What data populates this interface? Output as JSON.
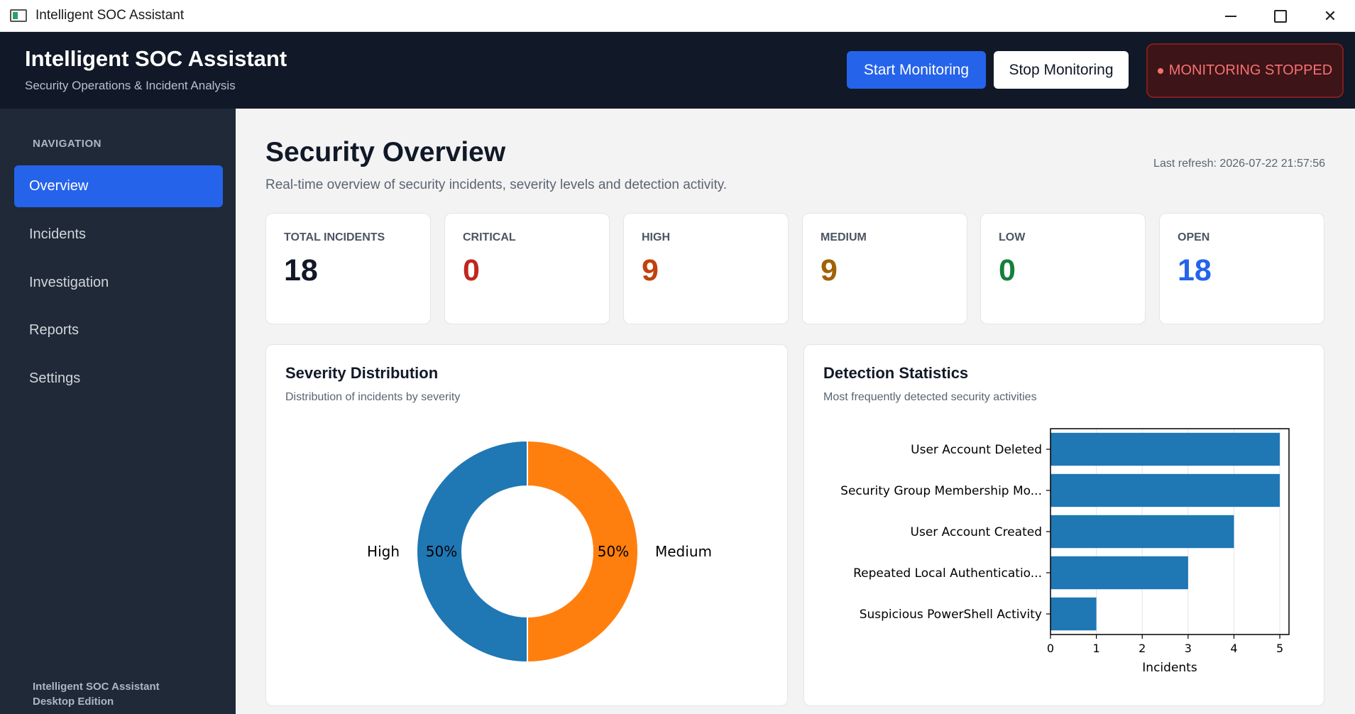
{
  "window": {
    "title": "Intelligent SOC Assistant"
  },
  "header": {
    "title": "Intelligent SOC Assistant",
    "subtitle": "Security Operations & Incident Analysis",
    "start_label": "Start Monitoring",
    "stop_label": "Stop Monitoring",
    "status_label": "MONITORING STOPPED"
  },
  "sidebar": {
    "heading": "NAVIGATION",
    "items": [
      {
        "label": "Overview",
        "active": true
      },
      {
        "label": "Incidents",
        "active": false
      },
      {
        "label": "Investigation",
        "active": false
      },
      {
        "label": "Reports",
        "active": false
      },
      {
        "label": "Settings",
        "active": false
      }
    ],
    "footer_line1": "Intelligent SOC Assistant",
    "footer_line2": "Desktop Edition"
  },
  "main": {
    "title": "Security Overview",
    "subtitle": "Real-time overview of security incidents, severity levels and detection activity.",
    "last_refresh": "Last refresh: 2026-07-22 21:57:56",
    "stats": [
      {
        "label": "TOTAL INCIDENTS",
        "value": "18",
        "color": "#111827"
      },
      {
        "label": "CRITICAL",
        "value": "0",
        "color": "#c0271f"
      },
      {
        "label": "HIGH",
        "value": "9",
        "color": "#c2410c"
      },
      {
        "label": "MEDIUM",
        "value": "9",
        "color": "#a16207"
      },
      {
        "label": "LOW",
        "value": "0",
        "color": "#15803d"
      },
      {
        "label": "OPEN",
        "value": "18",
        "color": "#2563eb"
      }
    ],
    "severity_panel": {
      "title": "Severity Distribution",
      "subtitle": "Distribution of incidents by severity"
    },
    "detection_panel": {
      "title": "Detection Statistics",
      "subtitle": "Most frequently detected security activities"
    }
  },
  "chart_data": [
    {
      "type": "pie",
      "categories": [
        "High",
        "Medium"
      ],
      "values": [
        9,
        9
      ],
      "percent_labels": [
        "50%",
        "50%"
      ],
      "colors": [
        "#1f77b4",
        "#ff7f0e"
      ],
      "donut": true
    },
    {
      "type": "bar",
      "orientation": "horizontal",
      "categories": [
        "User Account Deleted",
        "Security Group Membership Mo...",
        "User Account Created",
        "Repeated Local Authenticatio...",
        "Suspicious PowerShell Activity"
      ],
      "values": [
        5,
        5,
        4,
        3,
        1
      ],
      "xlabel": "Incidents",
      "xlim": [
        0,
        5.2
      ],
      "xticks": [
        0,
        1,
        2,
        3,
        4,
        5
      ],
      "color": "#1f77b4",
      "grid": "vertical"
    }
  ]
}
